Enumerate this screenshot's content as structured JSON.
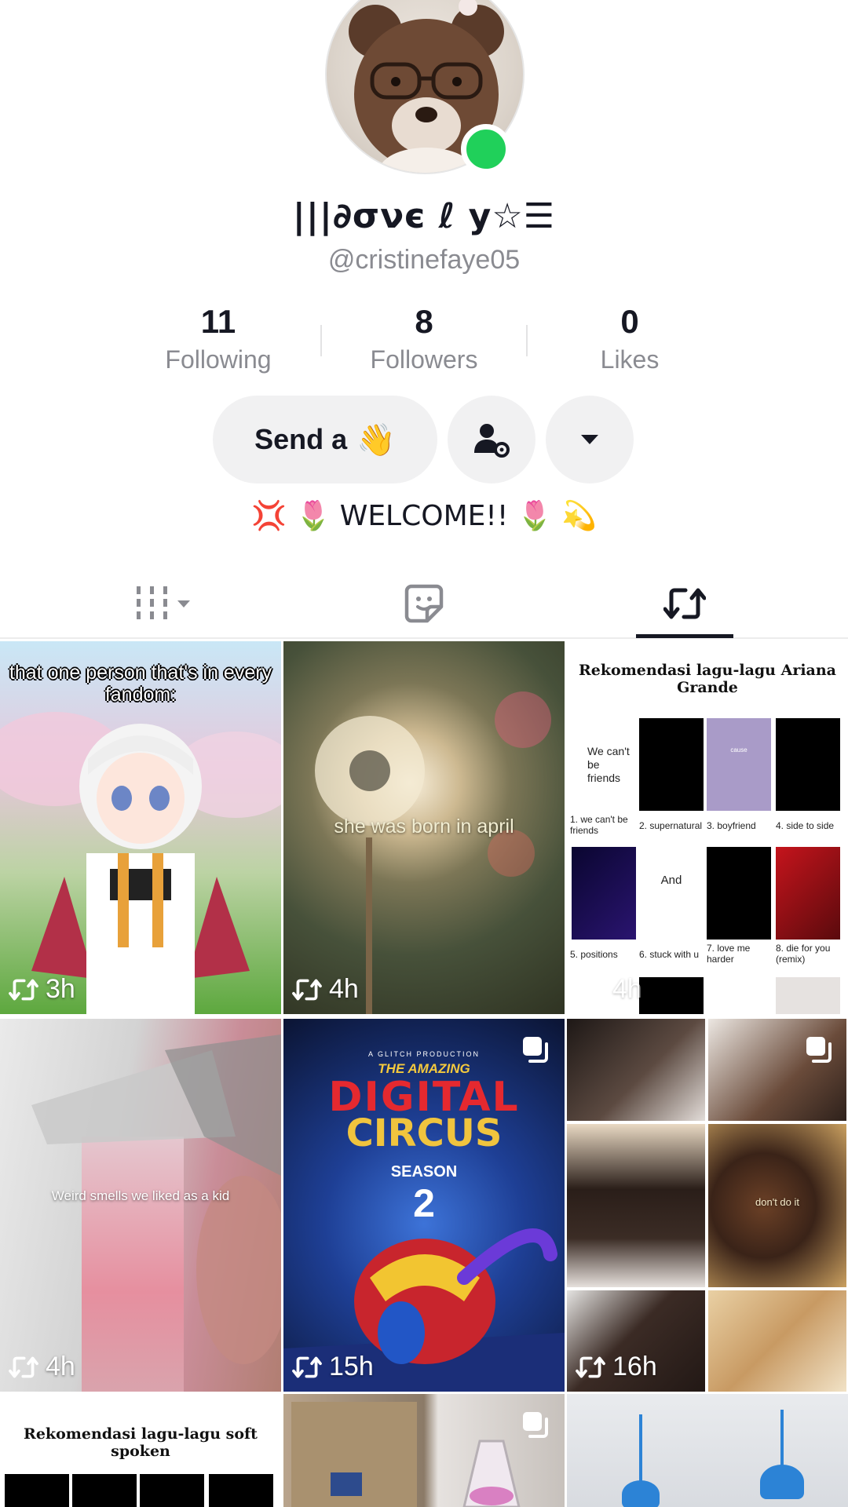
{
  "profile": {
    "display_name": "|||∂σνє ℓ у☆☰",
    "username": "@cristinefaye05",
    "online": true,
    "bio": {
      "emoji_left": "💢",
      "tulip": "🌷",
      "text": "WELCOME!!",
      "emoji_right": "💫"
    }
  },
  "stats": [
    {
      "value": "11",
      "label": "Following"
    },
    {
      "value": "8",
      "label": "Followers"
    },
    {
      "value": "0",
      "label": "Likes"
    }
  ],
  "actions": {
    "send_label": "Send a",
    "send_emoji": "👋",
    "person_icon": "person-settings-icon",
    "more_icon": "caret-down-icon"
  },
  "tabs": {
    "active": "reposts",
    "items": [
      "videos-grid-icon",
      "favorites-icon",
      "repost-icon"
    ]
  },
  "grid": {
    "t1": {
      "caption": "that one person that's in every fandom:",
      "time": "3h"
    },
    "t2": {
      "caption": "she was born in april",
      "time": "4h"
    },
    "t3": {
      "title": "Rekomendasi lagu-lagu Ariana Grande",
      "time": "4h",
      "songs": [
        "1. we can't be friends",
        "2. supernatural",
        "3. boyfriend",
        "4. side to side",
        "5. positions",
        "6. stuck with u",
        "7. love me harder",
        "8. die for you (remix)"
      ],
      "cell_texts": [
        "We can't be friends",
        "cause",
        "And"
      ]
    },
    "t4": {
      "caption": "Weird smells we liked as a kid",
      "time": "4h"
    },
    "t5": {
      "time": "15h",
      "poster": {
        "production": "A GLITCH PRODUCTION",
        "amazing": "THE AMAZING",
        "digital": "DIGITAL",
        "circus": "CIRCUS",
        "season": "SEASON",
        "number": "2"
      }
    },
    "t6": {
      "caption": "don't do it",
      "time": "16h"
    },
    "t7": {
      "title": "Rekomendasi lagu-lagu soft spoken"
    }
  },
  "colors": {
    "text": "#161823",
    "muted": "#8a8b91",
    "button_bg": "#f1f1f2",
    "online": "#20d05a"
  }
}
